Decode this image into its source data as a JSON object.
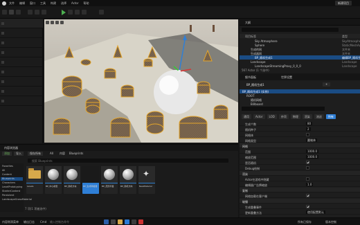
{
  "menubar": {
    "items": [
      "文件",
      "编辑",
      "窗口",
      "工具",
      "构建",
      "选择",
      "Actor",
      "帮助"
    ],
    "project_name": "新建项目"
  },
  "left_panel": {
    "labels": [
      "",
      "",
      "",
      "",
      "",
      "",
      "",
      "",
      ""
    ]
  },
  "outliner": {
    "title": "大纲",
    "search_placeholder": "搜索...",
    "col_label": "项目标签",
    "col_type": "类型",
    "rows": [
      {
        "name": "Sky Atmosphere",
        "type": "SkyAtmosphere"
      },
      {
        "name": "Sphere",
        "type": "StaticMeshActor"
      },
      {
        "name": "生成的网",
        "type": "文件夹"
      },
      {
        "name": "生成器网",
        "type": "文件夹"
      },
      {
        "name": "BP_随机生成1",
        "type": "编辑BP_随机生",
        "selected": true
      },
      {
        "name": "Landscape",
        "type": "Landscape"
      },
      {
        "name": "LandscapeStreamingProxy_0_0_0",
        "type": "Landscape"
      },
      {
        "name": "LandscapeStreamingProxy_0_1_0",
        "type": "Landscape"
      }
    ],
    "status": "567 Actor (1 个选中)"
  },
  "details": {
    "tab_details": "细节面板",
    "tab_world": "世界设置",
    "actor_name": "BP_随机生成1",
    "components": [
      {
        "label": "BP_随机生成1 (实例)",
        "level": 0,
        "selected": true
      },
      {
        "label": "ROOT",
        "level": 1
      },
      {
        "label": "随机网格",
        "level": 2
      },
      {
        "label": "Billboard",
        "level": 2
      }
    ],
    "filter_placeholder": "搜索",
    "category_tabs": [
      {
        "label": "通用",
        "on": false
      },
      {
        "label": "Actor",
        "on": false
      },
      {
        "label": "LOD",
        "on": false
      },
      {
        "label": "杂项",
        "on": false
      },
      {
        "label": "物理",
        "on": false
      },
      {
        "label": "渲染",
        "on": false
      },
      {
        "label": "流送",
        "on": false
      },
      {
        "label": "所有",
        "on": true
      }
    ],
    "props": [
      {
        "key": "生成个数",
        "value": "80",
        "kind": "text"
      },
      {
        "key": "随机种子",
        "value": "2",
        "kind": "text"
      },
      {
        "key": "网格体",
        "value": "",
        "kind": "check",
        "checked": false
      },
      {
        "key": "网格类型",
        "value": "圆锥体",
        "kind": "text"
      },
      {
        "key": "网格",
        "value": "",
        "kind": "cat"
      },
      {
        "key": "范围",
        "value": "1000.0",
        "kind": "text"
      },
      {
        "key": "缩放范围",
        "value": "1000.0",
        "kind": "text"
      },
      {
        "key": "是否随机",
        "value": "",
        "kind": "check",
        "checked": true
      },
      {
        "key": "Debug绘制",
        "value": "",
        "kind": "check",
        "checked": false
      },
      {
        "key": "渲染",
        "value": "",
        "kind": "cat"
      },
      {
        "key": "Actor在游戏中隐藏",
        "value": "",
        "kind": "check",
        "checked": false
      },
      {
        "key": "编辑器广告牌缩放",
        "value": "1.0",
        "kind": "text"
      },
      {
        "key": "复制",
        "value": "",
        "kind": "cat"
      },
      {
        "key": "网络加载在客户端",
        "value": "",
        "kind": "check",
        "checked": true
      },
      {
        "key": "碰撞",
        "value": "",
        "kind": "cat"
      },
      {
        "key": "生成重叠事件",
        "value": "",
        "kind": "check",
        "checked": true
      },
      {
        "key": "更新重叠方法",
        "value": "使用配置默认",
        "kind": "text"
      }
    ]
  },
  "content_browser": {
    "title": "内容浏览器",
    "add_label": "添加",
    "import_label": "导入",
    "save_all_label": "保存所有",
    "breadcrumb": [
      "All",
      "内容",
      "Blueprints"
    ],
    "search_placeholder": "搜索 Blueprints",
    "folders": [
      "Favorites",
      "All",
      "Content",
      "Blueprints",
      "Characters",
      "LevelPrototyping",
      "StarterContent",
      "Persistent",
      "LandscapeGrassMaterial"
    ],
    "selected_folder": 3,
    "assets": [
      {
        "name": "Levels",
        "kind": "folder"
      },
      {
        "name": "BP_中心模型",
        "kind": "sphere"
      },
      {
        "name": "BP_随机方块",
        "kind": "sphere"
      },
      {
        "name": "BP_生成网格器",
        "kind": "sel"
      },
      {
        "name": "BP_范围平面",
        "kind": "sphere"
      },
      {
        "name": "BP_随机方向",
        "kind": "sphere"
      },
      {
        "name": "NewMaterial",
        "kind": "sparkle"
      }
    ],
    "footer": "7 项(1 项被选中)"
  },
  "statusbar": {
    "left_label": "内容侧滑菜单",
    "output_label": "输出日志",
    "cmd_label": "Cmd",
    "cmd_placeholder": "输入控制台命令",
    "right_label": "所有已保存",
    "source_label": "版本控制"
  },
  "colors": {
    "accent": "#2f7fd6",
    "selection": "#1a4c84",
    "play_green": "#4caf50",
    "folder": "#d7a94b"
  }
}
